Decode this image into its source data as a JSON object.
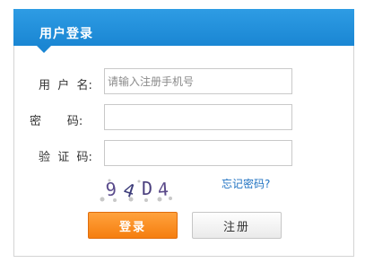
{
  "header": {
    "title": "用户登录"
  },
  "form": {
    "username_label": "用  户  名:",
    "username_placeholder": "请输入注册手机号",
    "password_label": "密       码:",
    "captcha_label": "验  证  码:",
    "captcha_text": "9 4 D 4",
    "forgot_link": "忘记密码?",
    "login_button": "登录",
    "register_button": "注册"
  },
  "colors": {
    "header": "#1a86d3",
    "login": "#f57e0f",
    "link": "#2173c2"
  }
}
